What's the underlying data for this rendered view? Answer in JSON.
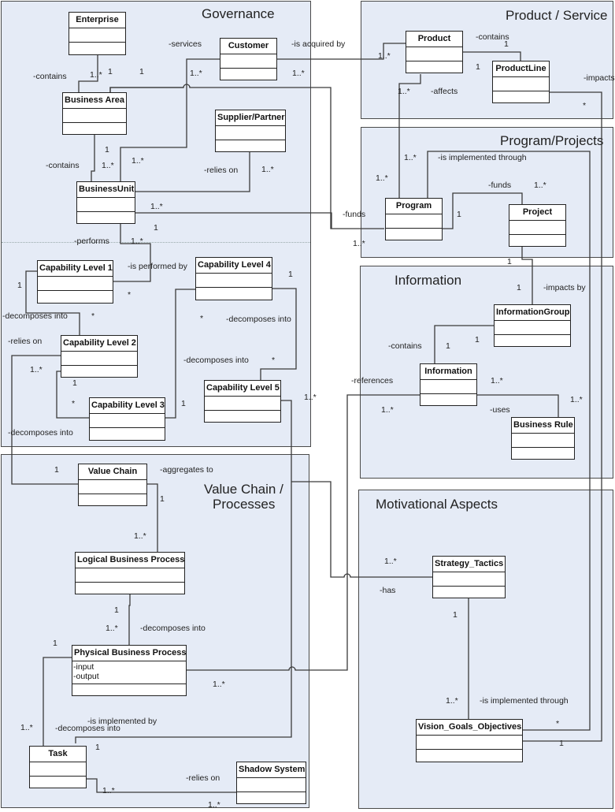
{
  "packages": {
    "governance": "Governance",
    "product_service": "Product / Service",
    "program_projects": "Program/Projects",
    "information": "Information",
    "value_chain_line1": "Value Chain /",
    "value_chain_line2": "Processes",
    "motivational": "Motivational Aspects"
  },
  "classes": {
    "enterprise": {
      "name": "Enterprise"
    },
    "customer": {
      "name": "Customer"
    },
    "business_area": {
      "name": "Business Area"
    },
    "supplier_partner": {
      "name": "Supplier/Partner"
    },
    "business_unit": {
      "name": "BusinessUnit"
    },
    "capability_1": {
      "name": "Capability Level 1"
    },
    "capability_2": {
      "name": "Capability Level 2"
    },
    "capability_3": {
      "name": "Capability Level 3"
    },
    "capability_4": {
      "name": "Capability Level 4"
    },
    "capability_5": {
      "name": "Capability Level 5"
    },
    "product": {
      "name": "Product"
    },
    "product_line": {
      "name": "ProductLine"
    },
    "program": {
      "name": "Program"
    },
    "project": {
      "name": "Project"
    },
    "information_group": {
      "name": "InformationGroup"
    },
    "information": {
      "name": "Information"
    },
    "business_rule": {
      "name": "Business Rule"
    },
    "value_chain": {
      "name": "Value Chain"
    },
    "logical_bp": {
      "name": "Logical Business Process"
    },
    "physical_bp": {
      "name": "Physical Business Process",
      "attributes": [
        "-input",
        "-output"
      ]
    },
    "task": {
      "name": "Task"
    },
    "shadow_system": {
      "name": "Shadow System"
    },
    "strategy_tactics": {
      "name": "Strategy_Tactics"
    },
    "vision_goals": {
      "name": "Vision_Goals_Objectives"
    }
  },
  "labels": {
    "contains_ent": "-contains",
    "m_ent_1star": "1..*",
    "m_ent_1": "1",
    "m_ba_1": "1",
    "services": "-services",
    "m_cust_1star_a": "1..*",
    "acquired_by": "-is acquired by",
    "m_cust_1star_b": "1..*",
    "m_prod_1star": "1..*",
    "contains_ba": "-contains",
    "m_ba_bu_1": "1",
    "m_ba_bu_1star": "1..*",
    "m_bu_cust_1star": "1..*",
    "relies_on_sup": "-relies on",
    "m_sup_1star": "1..*",
    "m_bu_funds_1star": "1..*",
    "m_bu_1": "1",
    "performs": "-performs",
    "m_perf_1star": "1..*",
    "is_performed_by": "-is performed by",
    "m_cap1_star": "*",
    "m_cap1_1": "1",
    "decomposes_12": "-decomposes into",
    "m_cap2_star": "*",
    "relies_on_cap": "-relies on",
    "m_cap2_1star": "1..*",
    "m_cap2_1": "1",
    "m_cap3_star": "*",
    "decomposes_vc": "-decomposes into",
    "m_cap4_1": "1",
    "m_cap4_star": "*",
    "decomposes_45": "-decomposes into",
    "decomposes_34": "-decomposes into",
    "m_cap5_star": "*",
    "m_cap3_1": "1",
    "m_cap5_1star": "1..*",
    "prod_contains": "-contains",
    "m_pl_1": "1",
    "m_prod_pl_1": "1",
    "affects": "-affects",
    "m_prod_aff_1star": "1..*",
    "impacts": "-impacts",
    "m_pl_star": "*",
    "m_prog_1star_a": "1..*",
    "is_impl_through_prog": "-is implemented through",
    "m_prog_1star_b": "1..*",
    "funds_proj": "-funds",
    "m_proj_1star": "1..*",
    "funds_bu": "-funds",
    "m_prog_1": "1",
    "m_prog_funds_1star": "1..*",
    "m_proj_1": "1",
    "m_ig_1": "1",
    "impacts_by": "-impacts by",
    "info_contains": "-contains",
    "m_info_1": "1",
    "m_ig_info_1": "1",
    "references": "-references",
    "m_info_1star": "1..*",
    "m_info_ref_1star": "1..*",
    "uses": "-uses",
    "m_br_1star": "1..*",
    "m_vc_1": "1",
    "aggregates_to": "-aggregates to",
    "m_vc_lbp_1": "1",
    "m_lbp_1star": "1..*",
    "m_lbp_1": "1",
    "m_pbp_1star": "1..*",
    "decomposes_lp": "-decomposes into",
    "m_pbp_1": "1",
    "m_pbp_ref_1star": "1..*",
    "m_task_1star": "1..*",
    "is_impl_by": "-is implemented by",
    "decomposes_task": "-decomposes into",
    "m_task_1": "1",
    "relies_on_shadow": "-relies on",
    "m_task_shadow_1star": "1..*",
    "m_shadow_1star": "1..*",
    "m_st_1star": "1..*",
    "has": "-has",
    "m_st_1": "1",
    "m_vgo_1star": "1..*",
    "is_impl_through_vgo": "-is implemented through",
    "m_vgo_star": "*",
    "m_vgo_1": "1"
  }
}
